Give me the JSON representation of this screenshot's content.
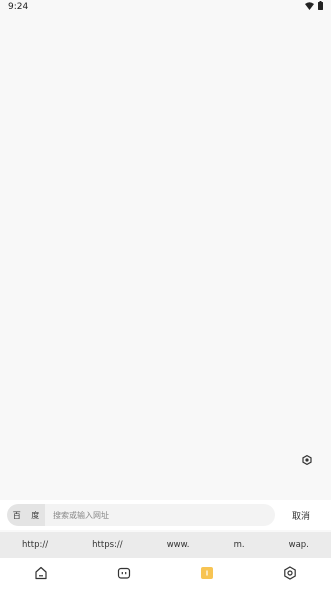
{
  "status_bar": {
    "time": "9:24",
    "icons": [
      "wifi-icon",
      "battery-icon"
    ]
  },
  "search": {
    "engine_label": "百 度",
    "placeholder": "搜索或输入网址",
    "value": "",
    "cancel_label": "取消"
  },
  "quick_inputs": [
    "http://",
    "https://",
    "www.",
    "m.",
    "wap."
  ],
  "bottom_nav": {
    "items": [
      {
        "icon": "home-icon"
      },
      {
        "icon": "robot-icon"
      },
      {
        "icon": "tabs-count-icon",
        "count": "1",
        "accent": "#f7c453"
      },
      {
        "icon": "settings-hexagon-icon"
      }
    ]
  },
  "floating_button": {
    "icon": "settings-hexagon-icon"
  }
}
